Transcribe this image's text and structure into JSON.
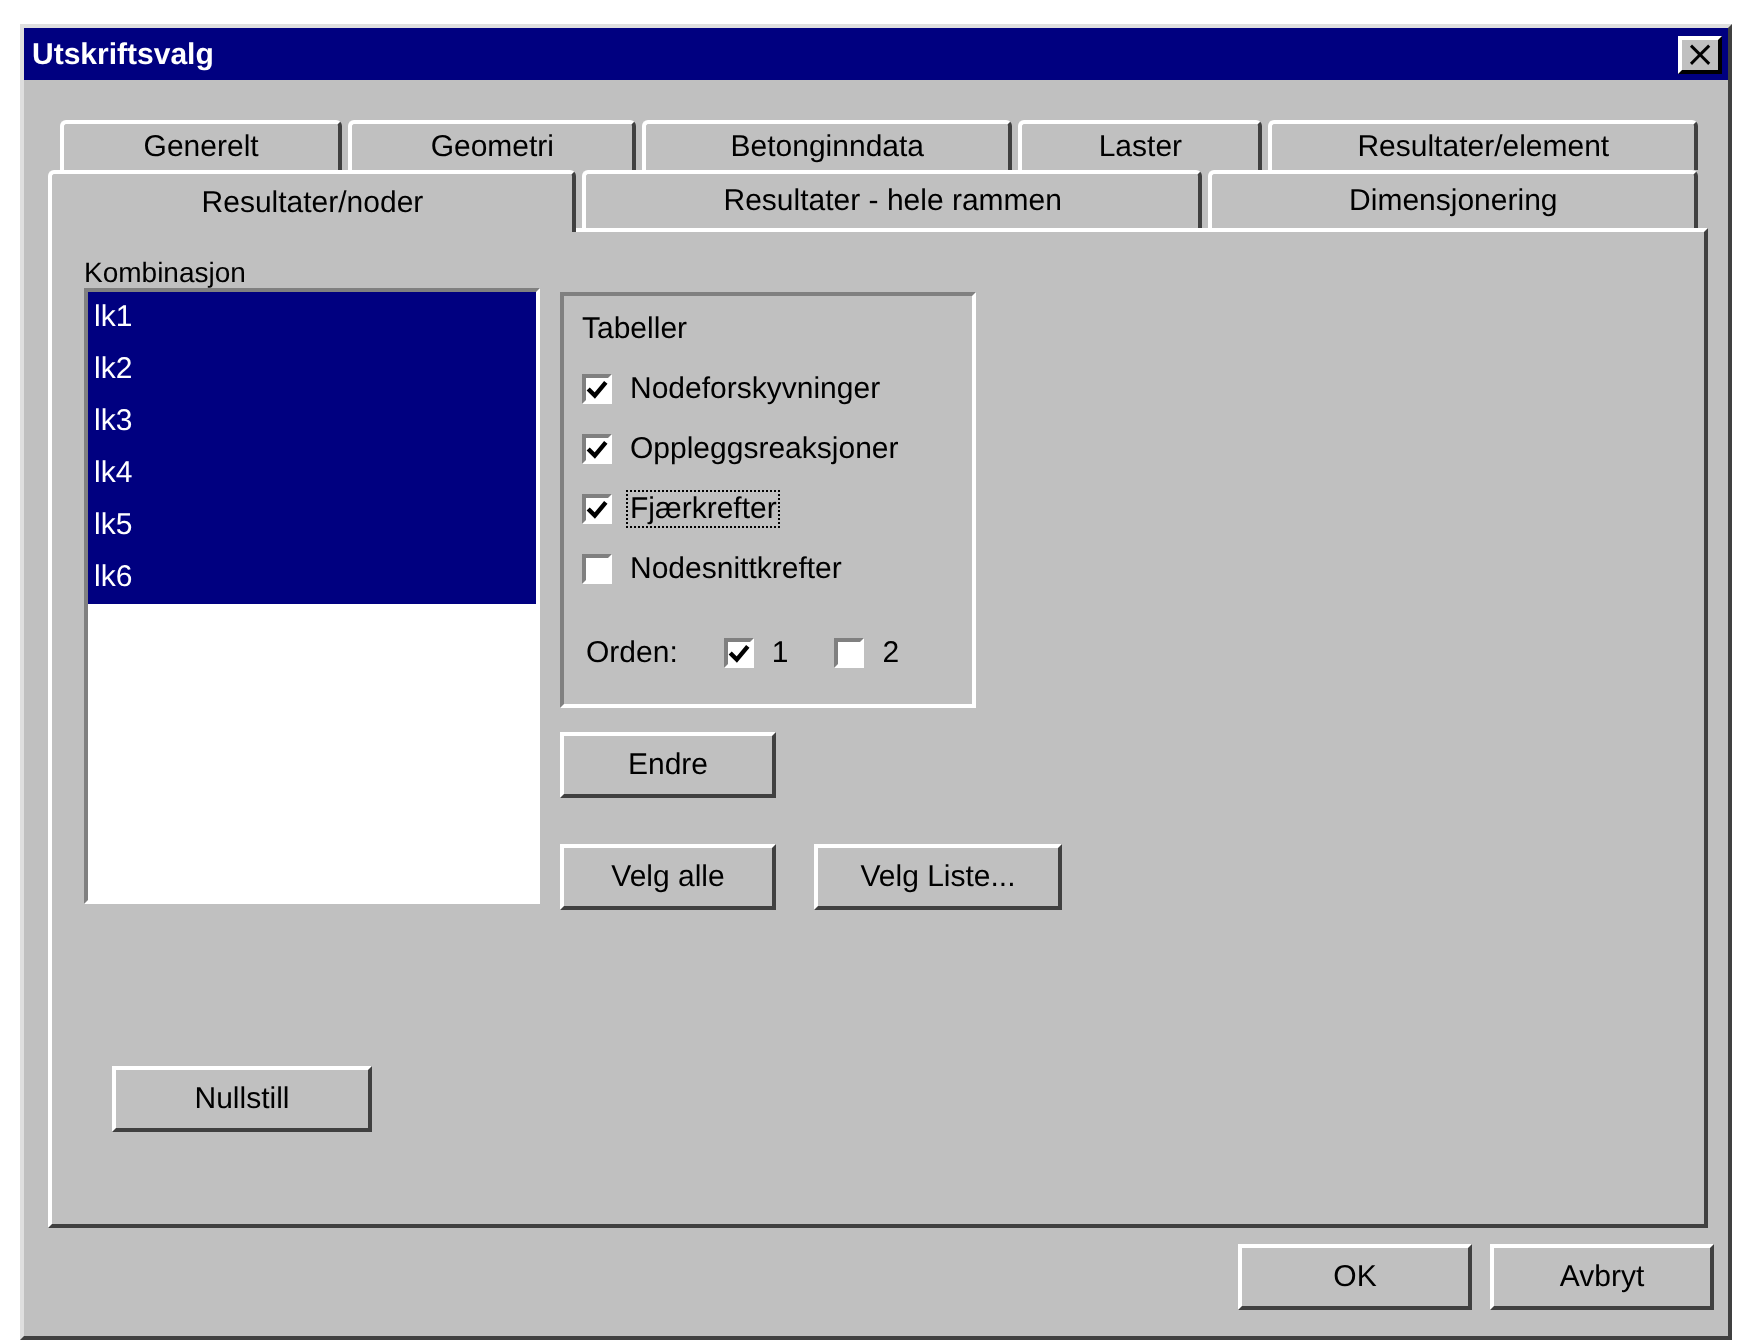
{
  "window": {
    "title": "Utskriftsvalg",
    "close": "×"
  },
  "tab_rows": [
    [
      {
        "label": "Generelt",
        "selected": false
      },
      {
        "label": "Geometri",
        "selected": false
      },
      {
        "label": "Betonginndata",
        "selected": false
      },
      {
        "label": "Laster",
        "selected": false
      },
      {
        "label": "Resultater/element",
        "selected": false
      }
    ],
    [
      {
        "label": "Resultater/noder",
        "selected": true
      },
      {
        "label": "Resultater - hele rammen",
        "selected": false
      },
      {
        "label": "Dimensjonering",
        "selected": false
      }
    ]
  ],
  "combinations": {
    "label": "Kombinasjon",
    "items": [
      {
        "label": "lk1",
        "selected": true
      },
      {
        "label": "lk2",
        "selected": true
      },
      {
        "label": "lk3",
        "selected": true
      },
      {
        "label": "lk4",
        "selected": true
      },
      {
        "label": "lk5",
        "selected": true
      },
      {
        "label": "lk6",
        "selected": true
      }
    ]
  },
  "tables": {
    "label": "Tabeller",
    "items": [
      {
        "label": "Nodeforskyvninger",
        "checked": true,
        "focused": false
      },
      {
        "label": "Oppleggsreaksjoner",
        "checked": true,
        "focused": false
      },
      {
        "label": "Fjærkrefter",
        "checked": true,
        "focused": true
      },
      {
        "label": "Nodesnittkrefter",
        "checked": false,
        "focused": false
      }
    ],
    "order_label": "Orden:",
    "order": [
      {
        "label": "1",
        "checked": true
      },
      {
        "label": "2",
        "checked": false
      }
    ]
  },
  "buttons": {
    "change": "Endre",
    "select_all": "Velg alle",
    "select_list": "Velg Liste...",
    "reset": "Nullstill"
  },
  "footer_buttons": [
    "OK",
    "Avbryt"
  ]
}
